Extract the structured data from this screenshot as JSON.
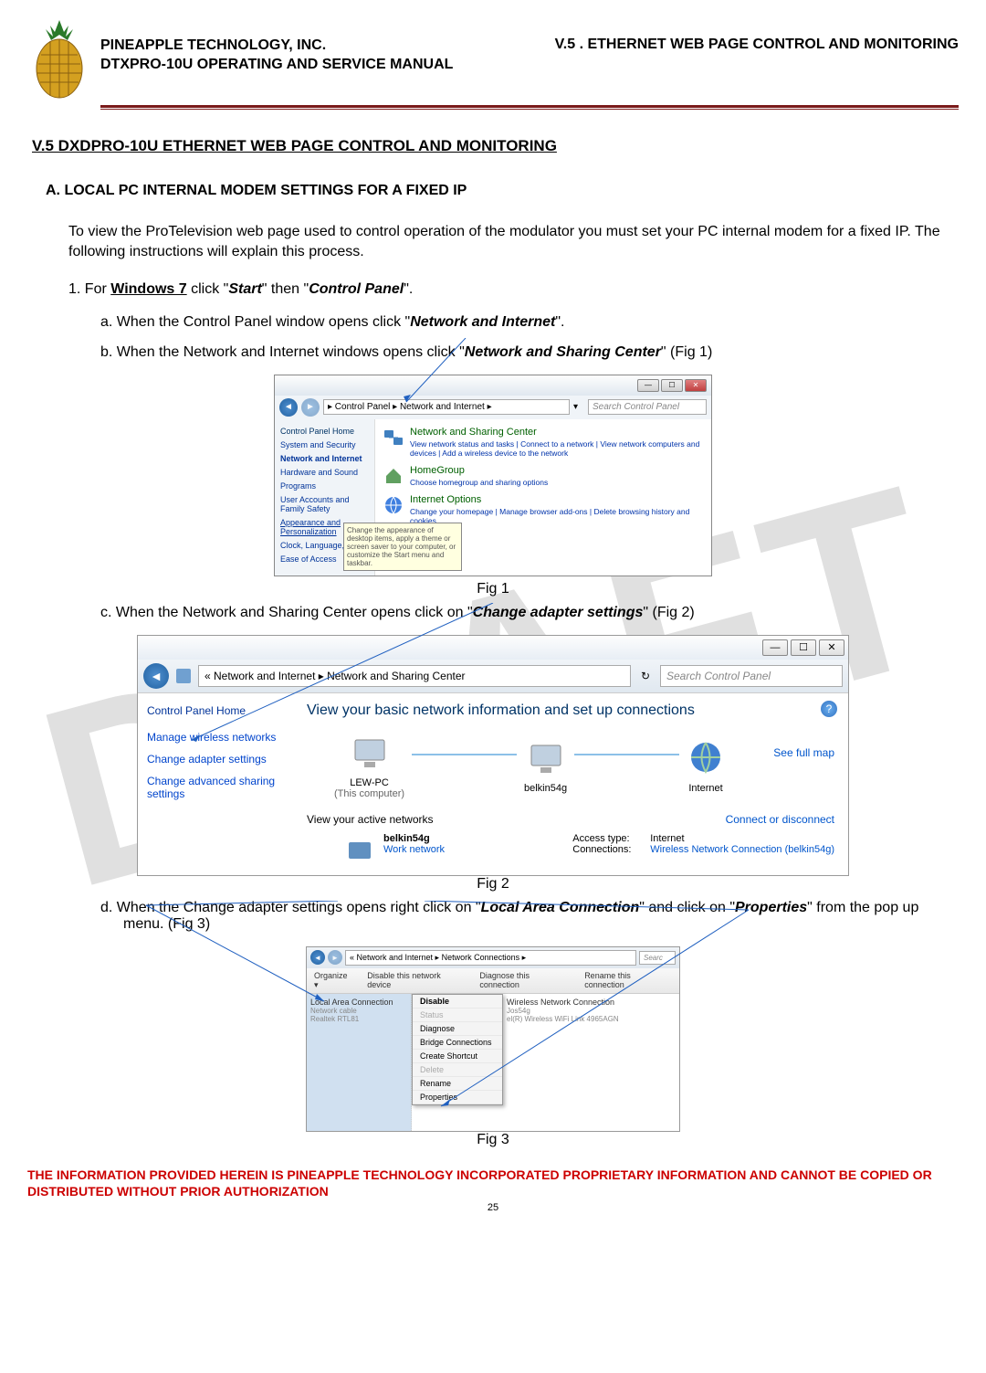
{
  "header": {
    "company": "PINEAPPLE TECHNOLOGY, INC.",
    "manual": "DTXPRO-10U OPERATING AND SERVICE MANUAL",
    "chapter": "V.5 . ETHERNET WEB PAGE CONTROL AND MONITORING"
  },
  "watermark": "DRAFT",
  "section_title": "V.5  DXDPRO-10U ETHERNET WEB PAGE CONTROL AND MONITORING",
  "subsection_a": "A.   LOCAL PC INTERNAL MODEM SETTINGS FOR A FIXED IP",
  "intro_text": "To view the ProTelevision web page used to control operation of the modulator you must set your PC internal modem for a fixed IP.  The following instructions will explain this process.",
  "step1": {
    "prefix": "1.    For ",
    "os": "Windows 7",
    "mid1": " click \"",
    "start": "Start",
    "mid2": "\" then \"",
    "cp": "Control Panel",
    "suffix": "\"."
  },
  "step_a": {
    "prefix": "a.    When the Control Panel window opens click \"",
    "target": "Network and Internet",
    "suffix": "\"."
  },
  "step_b": {
    "prefix": "b.    When the Network and Internet windows opens click \"",
    "target": "Network and Sharing Center",
    "suffix": "\" (Fig 1)"
  },
  "step_c": {
    "prefix": "c.    When the Network and Sharing Center opens click on \"",
    "target": "Change adapter settings",
    "suffix": "\" (Fig 2)"
  },
  "step_d": {
    "prefix": "d.    When the Change adapter settings opens right click on \"",
    "target1": "Local Area Connection",
    "mid": "\" and click on \"",
    "target2": "Properties",
    "suffix": "\" from the pop up menu. (Fig 3)"
  },
  "fig1": {
    "caption": "Fig 1",
    "breadcrumb": "▸ Control Panel ▸ Network and Internet ▸",
    "search_placeholder": "Search Control Panel",
    "sidebar": {
      "home": "Control Panel Home",
      "items": [
        "System and Security",
        "Network and Internet",
        "Hardware and Sound",
        "Programs",
        "User Accounts and Family Safety",
        "Appearance and Personalization",
        "Clock, Language,",
        "Ease of Access"
      ]
    },
    "categories": [
      {
        "title": "Network and Sharing Center",
        "links": "View network status and tasks | Connect to a network | View network computers and devices | Add a wireless device to the network"
      },
      {
        "title": "HomeGroup",
        "links": "Choose homegroup and sharing options"
      },
      {
        "title": "Internet Options",
        "links": "Change your homepage | Manage browser add-ons | Delete browsing history and cookies"
      }
    ],
    "tooltip": "Change the appearance of desktop items, apply a theme or screen saver to your computer, or customize the Start menu and taskbar."
  },
  "fig2": {
    "caption": "Fig 2",
    "breadcrumb": "« Network and Internet ▸ Network and Sharing Center",
    "search_placeholder": "Search Control Panel",
    "sidebar": {
      "home": "Control Panel Home",
      "links": [
        "Manage wireless networks",
        "Change adapter settings",
        "Change advanced sharing settings"
      ]
    },
    "heading": "View your basic network information and set up connections",
    "fullmap": "See full map",
    "nodes": [
      {
        "name": "LEW-PC",
        "sub": "(This computer)"
      },
      {
        "name": "belkin54g",
        "sub": ""
      },
      {
        "name": "Internet",
        "sub": ""
      }
    ],
    "active_label": "View your active networks",
    "connect_link": "Connect or disconnect",
    "network": {
      "name": "belkin54g",
      "type": "Work network",
      "access_label": "Access type:",
      "access_value": "Internet",
      "conn_label": "Connections:",
      "conn_value": "Wireless Network Connection (belkin54g)"
    }
  },
  "fig3": {
    "caption": "Fig 3",
    "breadcrumb": "« Network and Internet ▸ Network Connections ▸",
    "search_placeholder": "Searc",
    "toolbar": [
      "Organize ▾",
      "Disable this network device",
      "Diagnose this connection",
      "Rename this connection"
    ],
    "local_conn": {
      "title": "Local Area Connection",
      "line2": "Network cable",
      "line3": "Realtek RTL81"
    },
    "wireless_conn": {
      "title": "Wireless Network Connection",
      "line2": "Jos54g",
      "line3": "el(R) Wireless WiFi Link 4965AGN"
    },
    "menu": [
      "Disable",
      "Status",
      "Diagnose",
      "Bridge Connections",
      "Create Shortcut",
      "Delete",
      "Rename",
      "Properties"
    ]
  },
  "footer": {
    "proprietary": "THE INFORMATION PROVIDED HEREIN IS PINEAPPLE TECHNOLOGY INCORPORATED PROPRIETARY INFORMATION AND CANNOT BE COPIED OR DISTRIBUTED WITHOUT PRIOR AUTHORIZATION",
    "page": "25"
  }
}
